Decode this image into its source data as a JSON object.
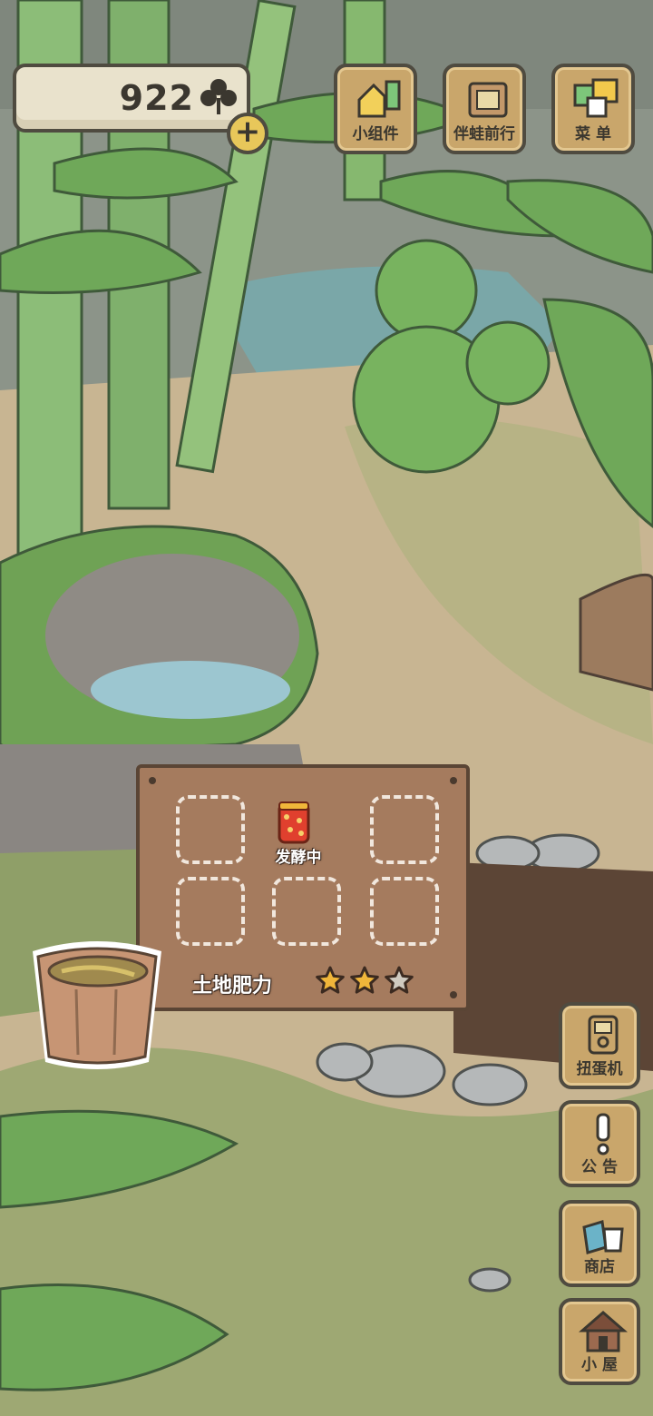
{
  "hud": {
    "clover_count": "922",
    "plus_symbol": "+",
    "top_buttons": [
      {
        "label": "小组件"
      },
      {
        "label": "伴蛙前行"
      },
      {
        "label": "菜 单"
      }
    ]
  },
  "field": {
    "slots": [
      {
        "status": ""
      },
      {
        "status": "发酵中",
        "icon": "fermenting-pot-icon"
      },
      {
        "status": ""
      },
      {
        "status": ""
      },
      {
        "status": ""
      },
      {
        "status": ""
      }
    ],
    "fertility_label": "土地肥力",
    "fertility_stars": 2,
    "fertility_max": 3
  },
  "side_buttons": [
    {
      "label": "扭蛋机",
      "icon": "gacha-machine-icon"
    },
    {
      "label": "公 告",
      "icon": "exclamation-icon"
    },
    {
      "label": "商店",
      "icon": "shop-bags-icon"
    },
    {
      "label": "小 屋",
      "icon": "house-icon"
    }
  ],
  "colors": {
    "wood": "#c9a66b",
    "board": "#a57b5e",
    "star_active": "#f0b63a",
    "star_inactive": "#cfcac0"
  }
}
